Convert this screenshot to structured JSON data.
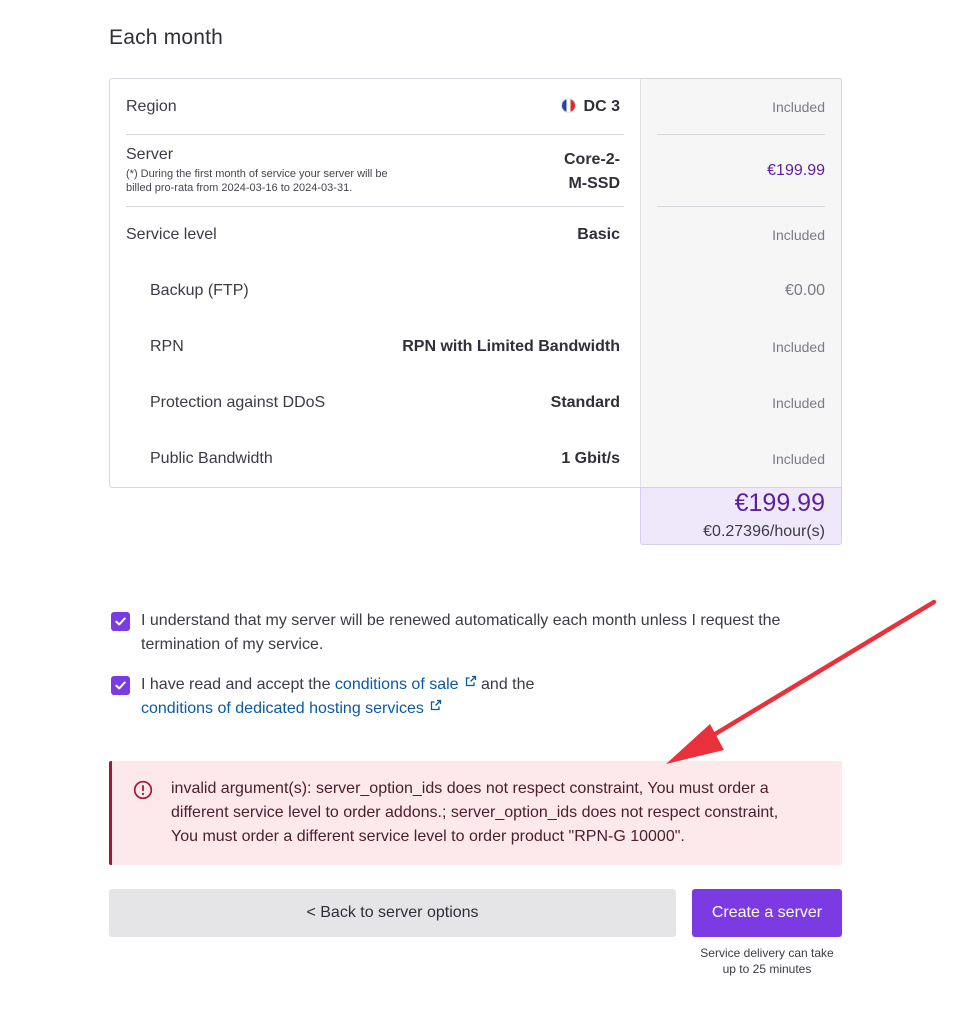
{
  "section_title": "Each month",
  "summary": {
    "region": {
      "label": "Region",
      "value": "DC 3",
      "price": "Included",
      "flag_icon": "france-flag-icon"
    },
    "server": {
      "label": "Server",
      "note_line1": "(*) During the first month of service your server will be",
      "note_line2": "billed pro-rata from 2024-03-16 to 2024-03-31.",
      "value_line1": "Core-2-",
      "value_line2": "M-SSD",
      "price": "€199.99"
    },
    "service_level": {
      "label": "Service level",
      "value": "Basic",
      "price": "Included"
    },
    "backup": {
      "label": "Backup (FTP)",
      "value": "",
      "price": "€0.00"
    },
    "rpn": {
      "label": "RPN",
      "value": "RPN with Limited Bandwidth",
      "price": "Included"
    },
    "ddos": {
      "label": "Protection against DDoS",
      "value": "Standard",
      "price": "Included"
    },
    "bandwidth": {
      "label": "Public Bandwidth",
      "value": "1 Gbit/s",
      "price": "Included"
    }
  },
  "total": {
    "monthly": "€199.99",
    "hourly": "€0.27396/hour(s)"
  },
  "agreements": {
    "renewal_line1": "I understand that my server will be renewed automatically each month unless I request the",
    "renewal_line2": "termination of my service.",
    "terms_prefix": "I have read and accept the",
    "conditions_of_sale": "conditions of sale",
    "terms_middle": "and the",
    "conditions_hosting": "conditions of dedicated hosting services"
  },
  "error": {
    "line1": "invalid argument(s): server_option_ids does not respect constraint, You must order a",
    "line2": "different service level to order addons.; server_option_ids does not respect constraint,",
    "line3": "You must order a different service level to order product \"RPN-G 10000\"."
  },
  "actions": {
    "back_label": "< Back to server options",
    "create_label": "Create a server",
    "delivery_line1": "Service delivery can take",
    "delivery_line2": "up to 25 minutes"
  },
  "colors": {
    "accent": "#7c3ae3",
    "price_accent": "#5b1f9c",
    "error_border": "#a3163d",
    "error_bg": "#fde8ec",
    "link": "#0c5aa0",
    "annotation_arrow": "#e8313b"
  }
}
